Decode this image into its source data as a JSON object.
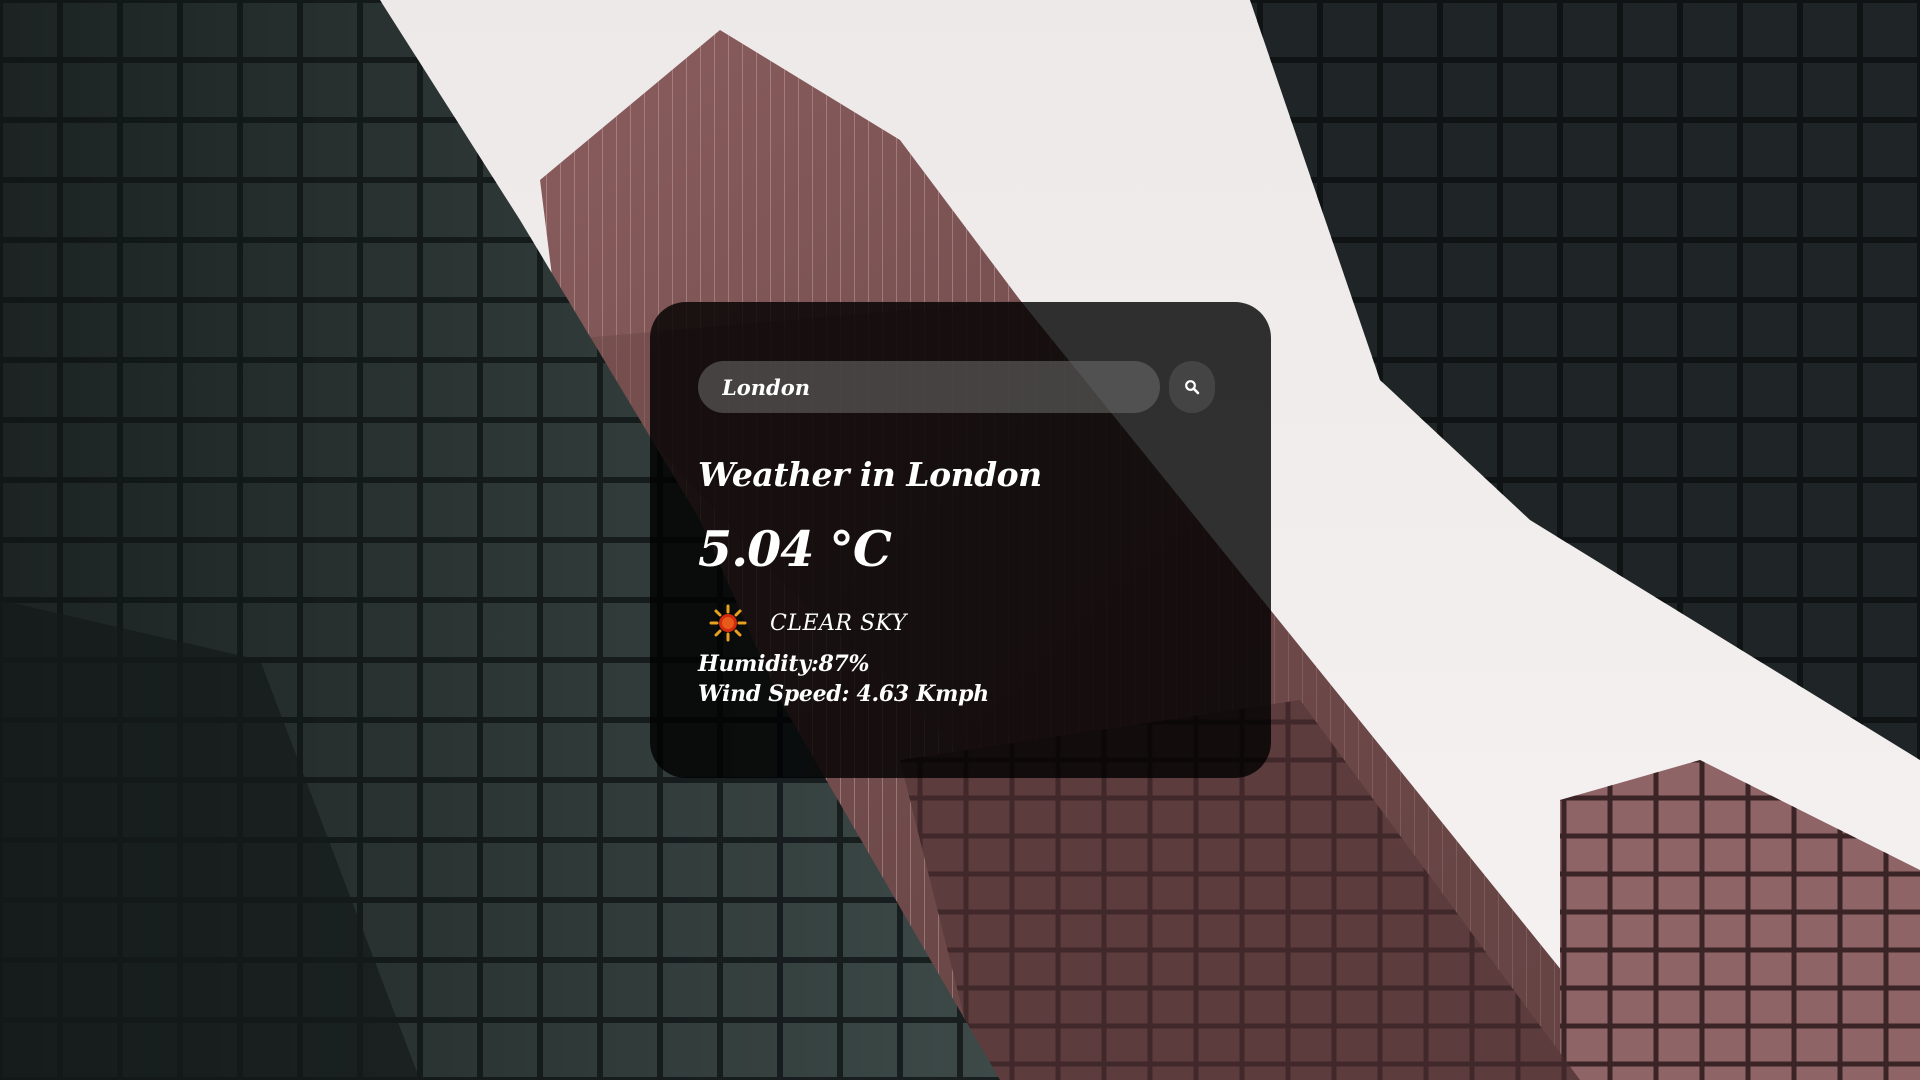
{
  "search": {
    "value": "London",
    "placeholder": "Search"
  },
  "weather": {
    "title": "Weather in London",
    "temperature": "5.04 °C",
    "condition": "CLEAR SKY",
    "condition_icon": "sun-icon",
    "humidity": "Humidity:87%",
    "wind": "Wind Speed: 4.63 Kmph"
  },
  "colors": {
    "card": "#000000cc",
    "text": "#ffffff",
    "sun": "#e8a020",
    "sun_core": "#d42a10"
  }
}
